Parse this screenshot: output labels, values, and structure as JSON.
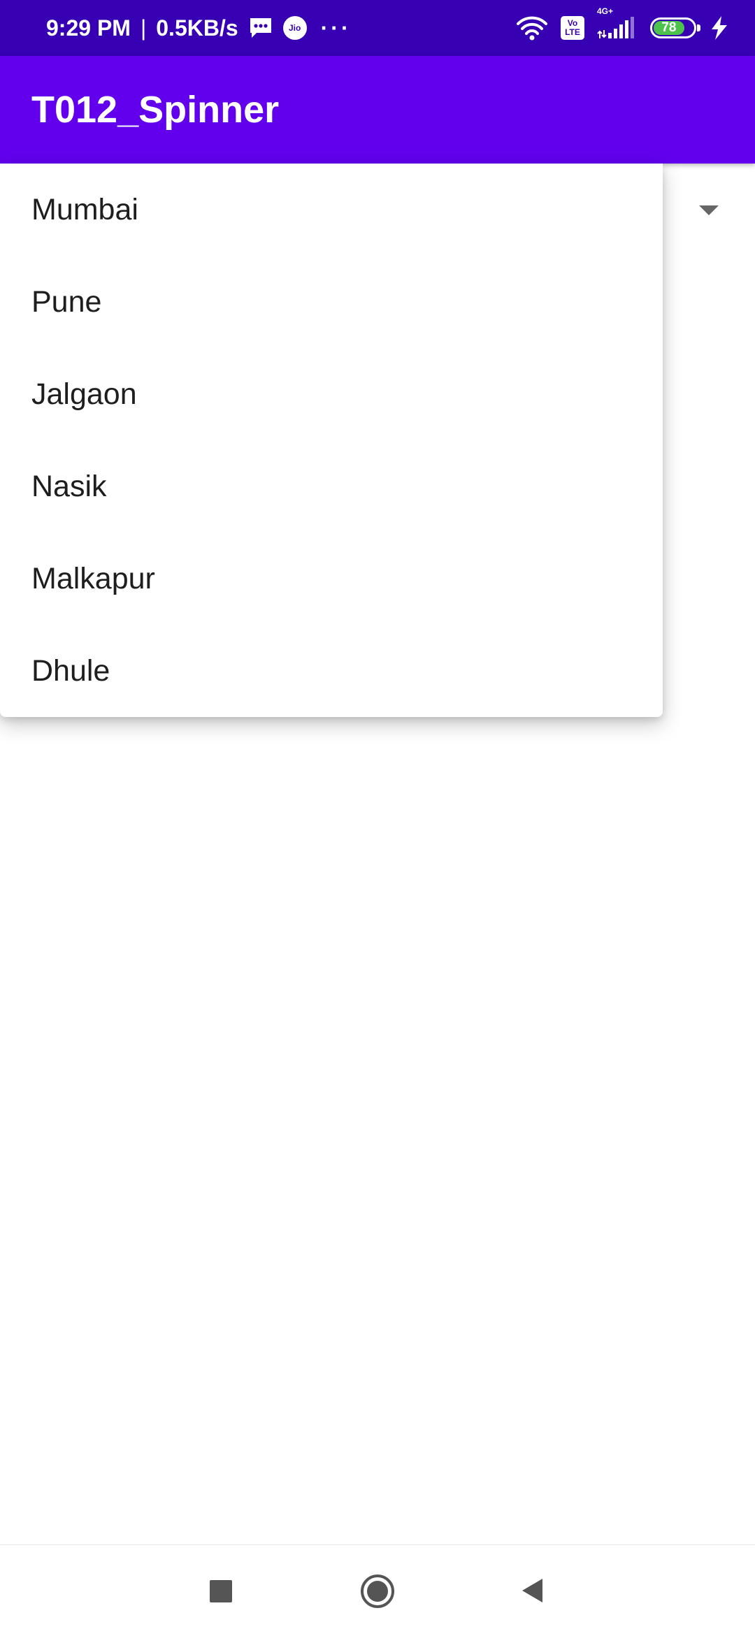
{
  "status_bar": {
    "time": "9:29 PM",
    "separator": "|",
    "speed": "0.5KB/s",
    "more": "···",
    "carrier_icon_text": "Jio",
    "volte_line1": "Vo",
    "volte_line2": "LTE",
    "network_type": "4G+",
    "battery_level": "78"
  },
  "app_bar": {
    "title": "T012_Spinner"
  },
  "spinner": {
    "options": [
      "Mumbai",
      "Pune",
      "Jalgaon",
      "Nasik",
      "Malkapur",
      "Dhule"
    ]
  },
  "nav_bar": {
    "recents_icon": "square-icon",
    "home_icon": "circle-icon",
    "back_icon": "triangle-icon"
  },
  "colors": {
    "status_bar": "#3700b3",
    "app_bar": "#6200ee",
    "battery_fill": "#4cc44c"
  }
}
